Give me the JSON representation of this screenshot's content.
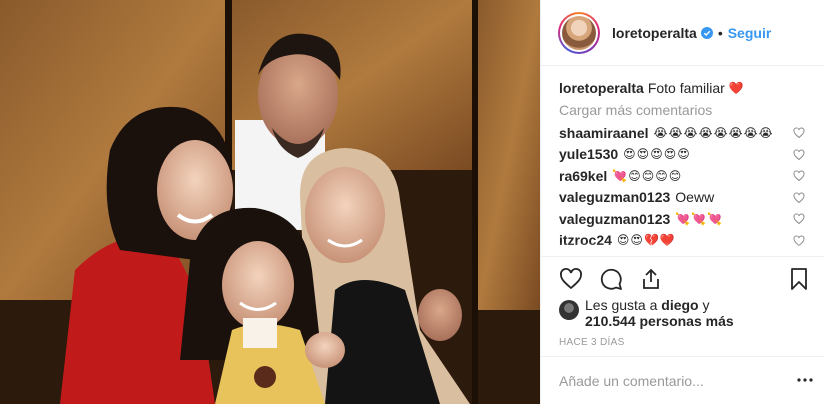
{
  "post": {
    "author": {
      "username": "loretoperalta",
      "verified_icon": "verified-badge-icon",
      "separator": "•",
      "follow_label": "Seguir"
    },
    "caption": {
      "username": "loretoperalta",
      "text": "Foto familiar",
      "emoji": "❤️"
    },
    "load_more_label": "Cargar más comentarios",
    "comments": [
      {
        "username": "shaamiraanel",
        "text": "😭😭😭😭😭😭😭😭"
      },
      {
        "username": "yule1530",
        "text": "😍😍😍😍😍"
      },
      {
        "username": "ra69kel",
        "text": "💘😊😊😊😊"
      },
      {
        "username": "valeguzman0123",
        "text": "Oeww"
      },
      {
        "username": "valeguzman0123",
        "text": "💘💘💘"
      },
      {
        "username": "itzroc24",
        "text": "😍😍💔❤️"
      }
    ],
    "likes": {
      "prefix": "Les gusta a",
      "user": "diego",
      "conjunction": "y",
      "count": "210.544 personas más"
    },
    "time_ago": "HACE 3 DÍAS",
    "add_comment_placeholder": "Añade un comentario...",
    "colors": {
      "link": "#3897f0",
      "text": "#262626",
      "muted": "#999999",
      "heart": "#ed4956"
    }
  }
}
